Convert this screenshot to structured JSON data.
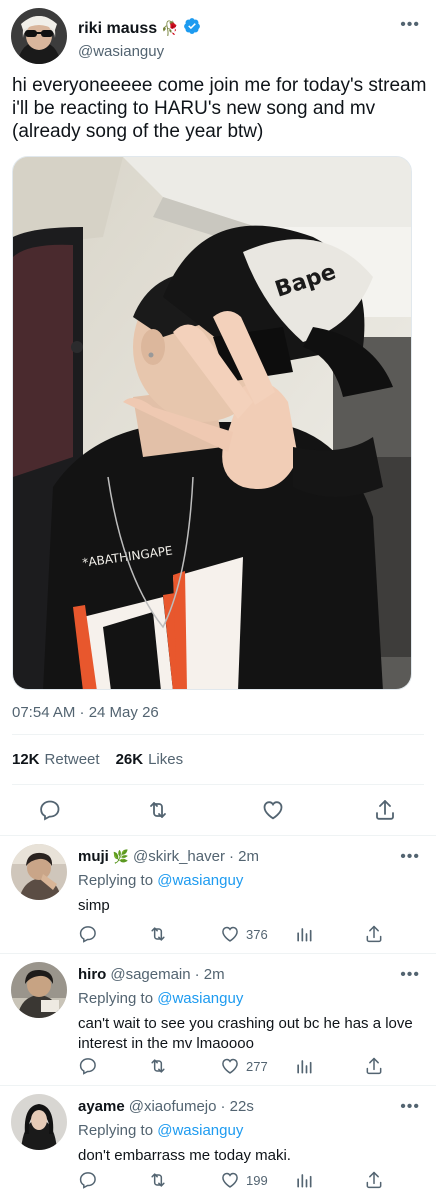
{
  "tweet": {
    "author_name": "riki mauss",
    "author_emoji": "🥀",
    "handle": "@wasianguy",
    "text": "hi everyoneeeee come join me for today's stream i'll be reacting to HARU's new song and mv (already song of the year btw)",
    "timestamp": "07:54 AM · 24 May 26",
    "retweets_count": "12K",
    "retweets_label": "Retweet",
    "likes_count": "26K",
    "likes_label": "Likes",
    "more_glyph": "•••",
    "media": {
      "cap_text": "Bape",
      "shirt_text": "*ABATHINGAPE"
    }
  },
  "replies": [
    {
      "name": "muji",
      "emoji": "🌿",
      "handle": "@skirk_haver",
      "time": "· 2m",
      "replying_label": "Replying to",
      "replying_to": "@wasianguy",
      "text": "simp",
      "likes": "376"
    },
    {
      "name": "hiro",
      "emoji": "",
      "handle": "@sagemain",
      "time": "· 2m",
      "replying_label": "Replying to",
      "replying_to": "@wasianguy",
      "text": "can't wait to see you crashing out bc he has a love interest in the mv lmaoooo",
      "likes": "277"
    },
    {
      "name": "ayame",
      "emoji": "",
      "handle": "@xiaofumejo",
      "time": "· 22s",
      "replying_label": "Replying to",
      "replying_to": "@wasianguy",
      "text": "don't embarrass me today maki.",
      "likes": "199"
    }
  ],
  "icons": {
    "verified": "verified-badge-icon",
    "reply": "reply-icon",
    "retweet": "retweet-icon",
    "like": "heart-icon",
    "share": "share-icon",
    "stats": "analytics-icon",
    "more": "more-icon"
  },
  "colors": {
    "accent": "#1d9bf0",
    "secondary_text": "#536471",
    "primary_text": "#0f1419"
  }
}
